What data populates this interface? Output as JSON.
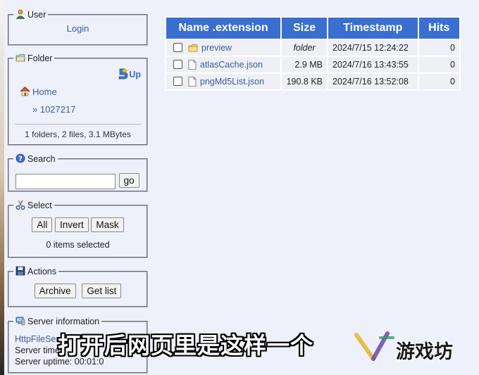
{
  "sidebar": {
    "user": {
      "legend": "User",
      "login_link": "Login"
    },
    "folder": {
      "legend": "Folder",
      "up_label": "Up",
      "home_link": "Home",
      "current_path": "» 1027217",
      "stats": "1 folders, 2 files, 3.1 MBytes"
    },
    "search": {
      "legend": "Search",
      "input_value": "",
      "go_label": "go"
    },
    "select": {
      "legend": "Select",
      "all_label": "All",
      "invert_label": "Invert",
      "mask_label": "Mask",
      "status": "0 items selected"
    },
    "actions": {
      "legend": "Actions",
      "archive_label": "Archive",
      "getlist_label": "Get list"
    },
    "server": {
      "legend": "Server information",
      "link_text": "HttpFileSer",
      "time_line": "Server time",
      "uptime_line": "Server uptime: 00:01:0"
    }
  },
  "file_table": {
    "headers": [
      "Name .extension",
      "Size",
      "Timestamp",
      "Hits"
    ],
    "rows": [
      {
        "name": "preview",
        "type": "folder",
        "size": "folder",
        "timestamp": "2024/7/15 12:24:22",
        "hits": "0"
      },
      {
        "name": "atlasCache.json",
        "type": "file",
        "size": "2.9 MB",
        "timestamp": "2024/7/16 13:43:55",
        "hits": "0"
      },
      {
        "name": "pngMd5List.json",
        "type": "file",
        "size": "190.8 KB",
        "timestamp": "2024/7/16 13:52:08",
        "hits": "0"
      }
    ]
  },
  "overlay": {
    "subtitle": "打开后网页里是这样一个",
    "watermark": "游戏坊"
  },
  "colors": {
    "header_bg": "#3a6fd0",
    "link": "#3b5d9a",
    "page_bg": "#eef0fa"
  },
  "icons": [
    "user-icon",
    "folder-icon",
    "up-icon",
    "home-icon",
    "search-icon",
    "scissors-icon",
    "save-icon",
    "server-icon",
    "file-icon"
  ]
}
